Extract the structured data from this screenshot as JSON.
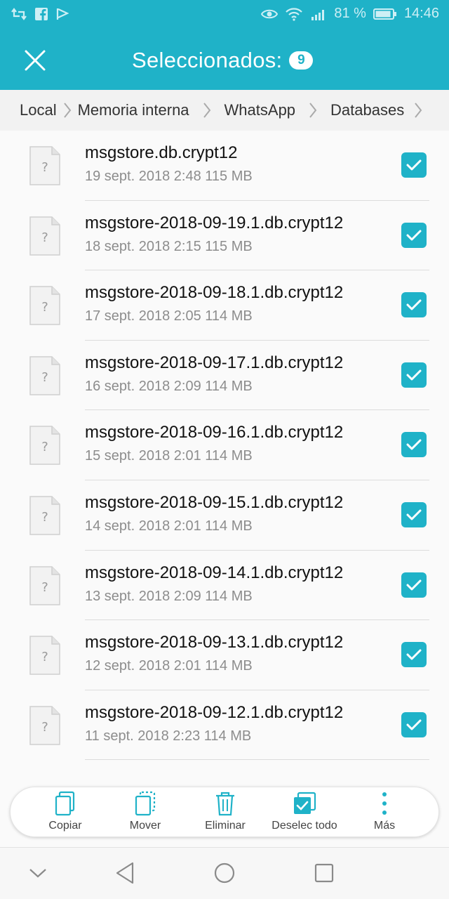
{
  "status_bar": {
    "battery_text": "81 %",
    "time": "14:46",
    "icons_left": [
      "retweet-icon",
      "facebook-icon",
      "flag-icon"
    ],
    "icons_right": [
      "eye-icon",
      "wifi-icon",
      "signal-icon",
      "battery-icon"
    ]
  },
  "header": {
    "title": "Seleccionados:",
    "count": "9",
    "close_icon": "close-icon",
    "color": "#1fb2c8"
  },
  "breadcrumb": [
    "Local",
    "Memoria interna",
    "WhatsApp",
    "Databases"
  ],
  "files": [
    {
      "name": "msgstore.db.crypt12",
      "meta": "19 sept. 2018 2:48 115 MB",
      "checked": true
    },
    {
      "name": "msgstore-2018-09-19.1.db.crypt12",
      "meta": "18 sept. 2018 2:15 115 MB",
      "checked": true
    },
    {
      "name": "msgstore-2018-09-18.1.db.crypt12",
      "meta": "17 sept. 2018 2:05 114 MB",
      "checked": true
    },
    {
      "name": "msgstore-2018-09-17.1.db.crypt12",
      "meta": "16 sept. 2018 2:09 114 MB",
      "checked": true
    },
    {
      "name": "msgstore-2018-09-16.1.db.crypt12",
      "meta": "15 sept. 2018 2:01 114 MB",
      "checked": true
    },
    {
      "name": "msgstore-2018-09-15.1.db.crypt12",
      "meta": "14 sept. 2018 2:01 114 MB",
      "checked": true
    },
    {
      "name": "msgstore-2018-09-14.1.db.crypt12",
      "meta": "13 sept. 2018 2:09 114 MB",
      "checked": true
    },
    {
      "name": "msgstore-2018-09-13.1.db.crypt12",
      "meta": "12 sept. 2018 2:01 114 MB",
      "checked": true
    },
    {
      "name": "msgstore-2018-09-12.1.db.crypt12",
      "meta": "11 sept. 2018 2:23 114 MB",
      "checked": true
    }
  ],
  "actions": [
    {
      "label": "Copiar",
      "icon": "copy-icon"
    },
    {
      "label": "Mover",
      "icon": "move-icon"
    },
    {
      "label": "Eliminar",
      "icon": "trash-icon"
    },
    {
      "label": "Deselec todo",
      "icon": "deselect-all-icon"
    },
    {
      "label": "Más",
      "icon": "more-icon"
    }
  ],
  "nav": [
    "collapse-icon",
    "back-icon",
    "home-icon",
    "recents-icon"
  ]
}
